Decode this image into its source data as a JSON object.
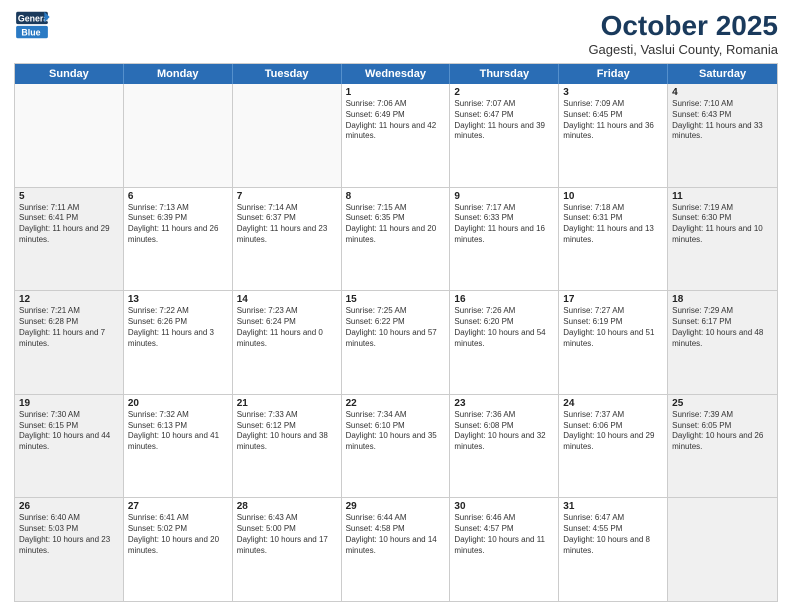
{
  "header": {
    "logo_line1": "General",
    "logo_line2": "Blue",
    "month": "October 2025",
    "location": "Gagesti, Vaslui County, Romania"
  },
  "weekdays": [
    "Sunday",
    "Monday",
    "Tuesday",
    "Wednesday",
    "Thursday",
    "Friday",
    "Saturday"
  ],
  "rows": [
    [
      {
        "day": "",
        "text": "",
        "empty": true
      },
      {
        "day": "",
        "text": "",
        "empty": true
      },
      {
        "day": "",
        "text": "",
        "empty": true
      },
      {
        "day": "1",
        "text": "Sunrise: 7:06 AM\nSunset: 6:49 PM\nDaylight: 11 hours and 42 minutes."
      },
      {
        "day": "2",
        "text": "Sunrise: 7:07 AM\nSunset: 6:47 PM\nDaylight: 11 hours and 39 minutes."
      },
      {
        "day": "3",
        "text": "Sunrise: 7:09 AM\nSunset: 6:45 PM\nDaylight: 11 hours and 36 minutes."
      },
      {
        "day": "4",
        "text": "Sunrise: 7:10 AM\nSunset: 6:43 PM\nDaylight: 11 hours and 33 minutes.",
        "shaded": true
      }
    ],
    [
      {
        "day": "5",
        "text": "Sunrise: 7:11 AM\nSunset: 6:41 PM\nDaylight: 11 hours and 29 minutes.",
        "shaded": true
      },
      {
        "day": "6",
        "text": "Sunrise: 7:13 AM\nSunset: 6:39 PM\nDaylight: 11 hours and 26 minutes."
      },
      {
        "day": "7",
        "text": "Sunrise: 7:14 AM\nSunset: 6:37 PM\nDaylight: 11 hours and 23 minutes."
      },
      {
        "day": "8",
        "text": "Sunrise: 7:15 AM\nSunset: 6:35 PM\nDaylight: 11 hours and 20 minutes."
      },
      {
        "day": "9",
        "text": "Sunrise: 7:17 AM\nSunset: 6:33 PM\nDaylight: 11 hours and 16 minutes."
      },
      {
        "day": "10",
        "text": "Sunrise: 7:18 AM\nSunset: 6:31 PM\nDaylight: 11 hours and 13 minutes."
      },
      {
        "day": "11",
        "text": "Sunrise: 7:19 AM\nSunset: 6:30 PM\nDaylight: 11 hours and 10 minutes.",
        "shaded": true
      }
    ],
    [
      {
        "day": "12",
        "text": "Sunrise: 7:21 AM\nSunset: 6:28 PM\nDaylight: 11 hours and 7 minutes.",
        "shaded": true
      },
      {
        "day": "13",
        "text": "Sunrise: 7:22 AM\nSunset: 6:26 PM\nDaylight: 11 hours and 3 minutes."
      },
      {
        "day": "14",
        "text": "Sunrise: 7:23 AM\nSunset: 6:24 PM\nDaylight: 11 hours and 0 minutes."
      },
      {
        "day": "15",
        "text": "Sunrise: 7:25 AM\nSunset: 6:22 PM\nDaylight: 10 hours and 57 minutes."
      },
      {
        "day": "16",
        "text": "Sunrise: 7:26 AM\nSunset: 6:20 PM\nDaylight: 10 hours and 54 minutes."
      },
      {
        "day": "17",
        "text": "Sunrise: 7:27 AM\nSunset: 6:19 PM\nDaylight: 10 hours and 51 minutes."
      },
      {
        "day": "18",
        "text": "Sunrise: 7:29 AM\nSunset: 6:17 PM\nDaylight: 10 hours and 48 minutes.",
        "shaded": true
      }
    ],
    [
      {
        "day": "19",
        "text": "Sunrise: 7:30 AM\nSunset: 6:15 PM\nDaylight: 10 hours and 44 minutes.",
        "shaded": true
      },
      {
        "day": "20",
        "text": "Sunrise: 7:32 AM\nSunset: 6:13 PM\nDaylight: 10 hours and 41 minutes."
      },
      {
        "day": "21",
        "text": "Sunrise: 7:33 AM\nSunset: 6:12 PM\nDaylight: 10 hours and 38 minutes."
      },
      {
        "day": "22",
        "text": "Sunrise: 7:34 AM\nSunset: 6:10 PM\nDaylight: 10 hours and 35 minutes."
      },
      {
        "day": "23",
        "text": "Sunrise: 7:36 AM\nSunset: 6:08 PM\nDaylight: 10 hours and 32 minutes."
      },
      {
        "day": "24",
        "text": "Sunrise: 7:37 AM\nSunset: 6:06 PM\nDaylight: 10 hours and 29 minutes."
      },
      {
        "day": "25",
        "text": "Sunrise: 7:39 AM\nSunset: 6:05 PM\nDaylight: 10 hours and 26 minutes.",
        "shaded": true
      }
    ],
    [
      {
        "day": "26",
        "text": "Sunrise: 6:40 AM\nSunset: 5:03 PM\nDaylight: 10 hours and 23 minutes.",
        "shaded": true
      },
      {
        "day": "27",
        "text": "Sunrise: 6:41 AM\nSunset: 5:02 PM\nDaylight: 10 hours and 20 minutes."
      },
      {
        "day": "28",
        "text": "Sunrise: 6:43 AM\nSunset: 5:00 PM\nDaylight: 10 hours and 17 minutes."
      },
      {
        "day": "29",
        "text": "Sunrise: 6:44 AM\nSunset: 4:58 PM\nDaylight: 10 hours and 14 minutes."
      },
      {
        "day": "30",
        "text": "Sunrise: 6:46 AM\nSunset: 4:57 PM\nDaylight: 10 hours and 11 minutes."
      },
      {
        "day": "31",
        "text": "Sunrise: 6:47 AM\nSunset: 4:55 PM\nDaylight: 10 hours and 8 minutes."
      },
      {
        "day": "",
        "text": "",
        "empty": true,
        "shaded": true
      }
    ]
  ]
}
